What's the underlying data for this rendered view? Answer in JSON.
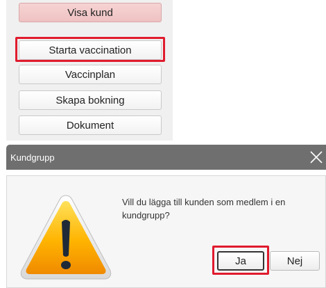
{
  "action_panel": {
    "buttons": [
      {
        "label": "Visa kund"
      },
      {
        "label": "Starta vaccination"
      },
      {
        "label": "Vaccinplan"
      },
      {
        "label": "Skapa bokning"
      },
      {
        "label": "Dokument"
      }
    ]
  },
  "dialog": {
    "title": "Kundgrupp",
    "message": "Vill du lägga till kunden som medlem i en kundgrupp?",
    "yes_label": "Ja",
    "no_label": "Nej",
    "icon": "warning-icon"
  },
  "colors": {
    "highlight": "#e01b2e",
    "title_bar": "#6f6f6f",
    "active_button": "#f6d3d3"
  }
}
